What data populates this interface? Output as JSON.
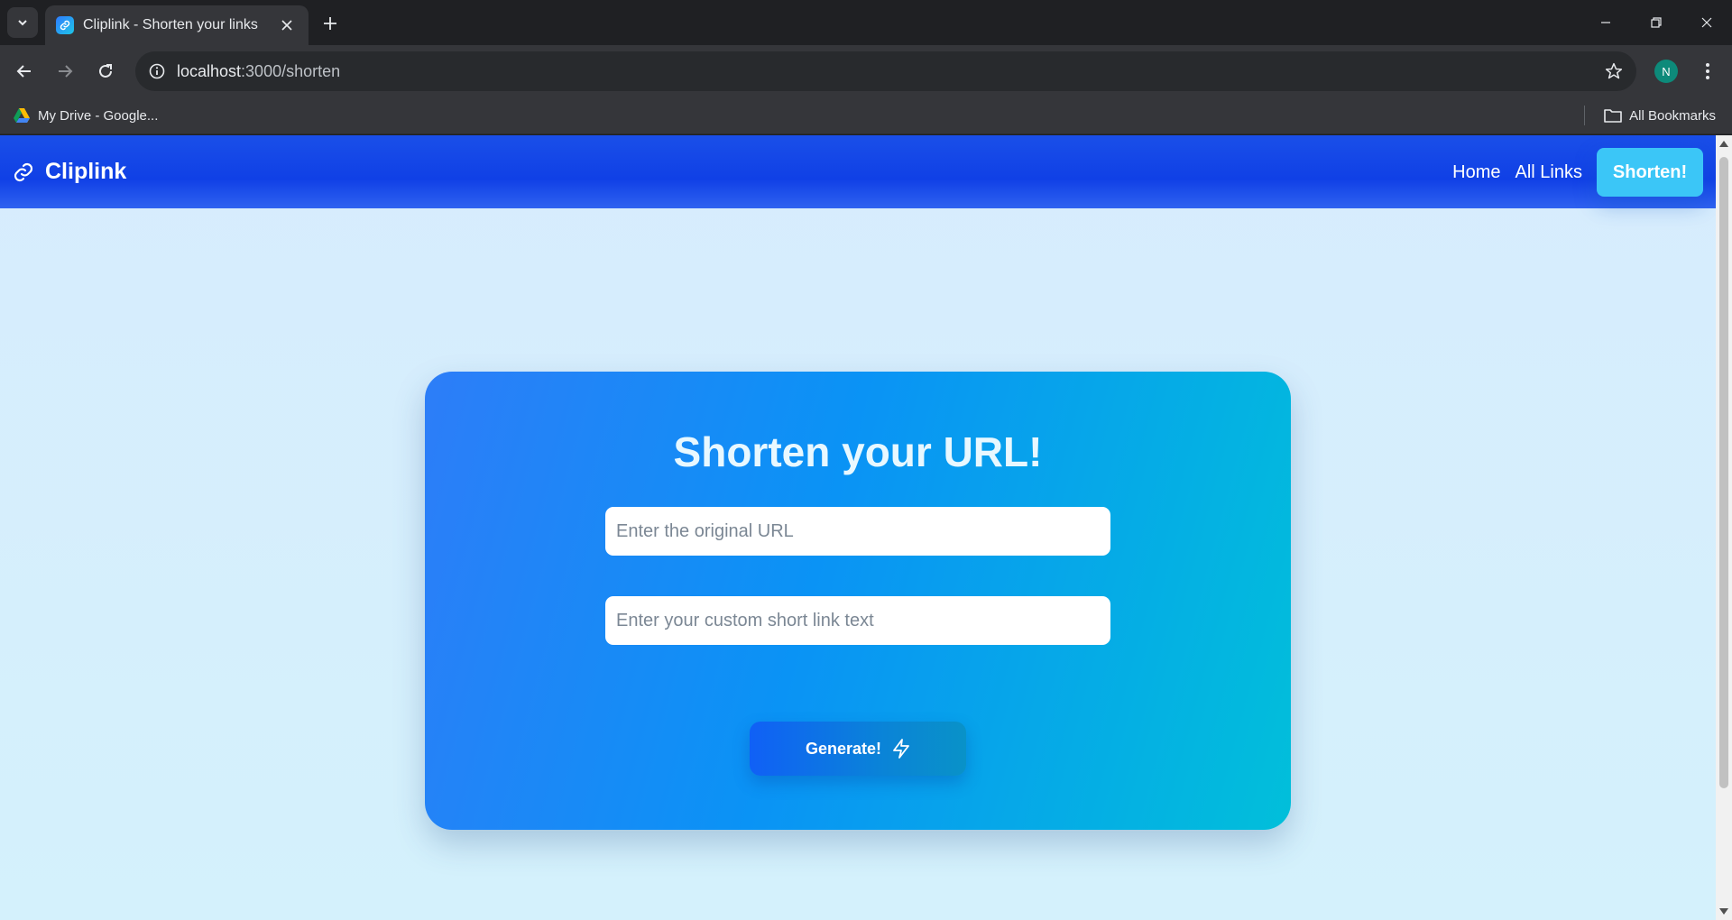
{
  "browser": {
    "tab_title": "Cliplink - Shorten your links",
    "url_host": "localhost",
    "url_path": ":3000/shorten",
    "profile_initial": "N",
    "bookmarks": [
      {
        "label": "My Drive - Google...",
        "icon": "google-drive-icon"
      }
    ],
    "all_bookmarks_label": "All Bookmarks"
  },
  "navbar": {
    "brand": "Cliplink",
    "brand_icon": "link-icon",
    "links": [
      {
        "label": "Home"
      },
      {
        "label": "All Links"
      }
    ],
    "cta_label": "Shorten!"
  },
  "form": {
    "title": "Shorten your URL!",
    "url_placeholder": "Enter the original URL",
    "url_value": "",
    "custom_placeholder": "Enter your custom short link text",
    "custom_value": "",
    "submit_label": "Generate!",
    "submit_icon": "lightning-icon"
  },
  "colors": {
    "navbar": "#1a4fe8",
    "cta": "#3bc6f7",
    "card_start": "#2d7df8",
    "card_end": "#01bfda",
    "page_bg": "#d7ecfd"
  }
}
